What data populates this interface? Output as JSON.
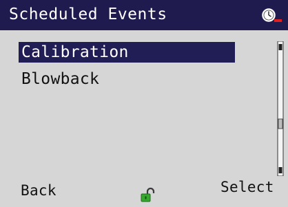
{
  "header": {
    "title": "Scheduled Events",
    "status_icon": "clock-alarm-icon",
    "background": "#1f1b4e",
    "alert_color": "#e02020"
  },
  "menu": {
    "items": [
      {
        "label": "Calibration",
        "selected": true
      },
      {
        "label": "Blowback",
        "selected": false
      }
    ],
    "selection_color": "#211d55"
  },
  "scrollbar": {
    "position_fraction": 0.58
  },
  "footer": {
    "back_label": "Back",
    "select_label": "Select",
    "lock_icon": "unlocked-padlock-icon",
    "lock_color": "#36a82e"
  }
}
